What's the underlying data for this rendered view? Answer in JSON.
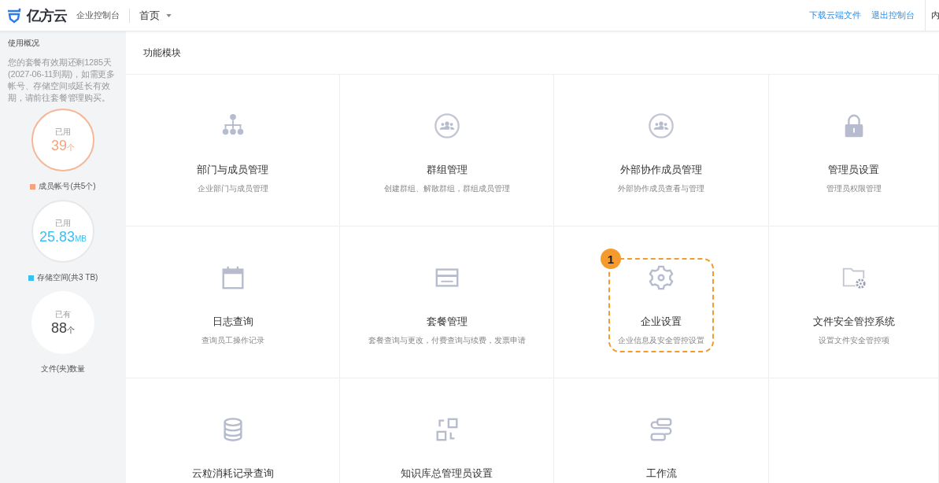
{
  "header": {
    "logo_text": "亿方云",
    "console_label": "企业控制台",
    "nav": {
      "label": "首页"
    },
    "links": [
      "下载云端文件",
      "退出控制台"
    ],
    "cut_text": "内"
  },
  "sidebar": {
    "title": "使用概况",
    "notice": "您的套餐有效期还剩1285天(2027-06-11到期)，如需更多帐号、存储空间或延长有效期，请前往套餐管理购买。",
    "stats": [
      {
        "caption": "已用",
        "value": "39",
        "unit": "个",
        "legend": "成员帐号(共5个)",
        "color": "#f4a37c",
        "over_limit": true
      },
      {
        "caption": "已用",
        "value": "25.83",
        "unit": "MB",
        "legend": "存储空间(共3 TB)",
        "color": "#3bbff0",
        "over_limit": false
      },
      {
        "caption": "已有",
        "value": "88",
        "unit": "个",
        "legend": "文件(夹)数量",
        "over_limit": false
      }
    ]
  },
  "main": {
    "title": "功能模块",
    "modules": [
      {
        "title": "部门与成员管理",
        "desc": "企业部门与成员管理",
        "highlighted": false
      },
      {
        "title": "群组管理",
        "desc": "创建群组、解散群组，群组成员管理",
        "highlighted": false
      },
      {
        "title": "外部协作成员管理",
        "desc": "外部协作成员查看与管理",
        "highlighted": false
      },
      {
        "title": "管理员设置",
        "desc": "管理员权限管理",
        "highlighted": false
      },
      {
        "title": "日志查询",
        "desc": "查询员工操作记录",
        "highlighted": false
      },
      {
        "title": "套餐管理",
        "desc": "套餐查询与更改，付费查询与续费，发票申请",
        "highlighted": false
      },
      {
        "title": "企业设置",
        "desc": "企业信息及安全管控设置",
        "highlighted": true,
        "badge": "1"
      },
      {
        "title": "文件安全管控系统",
        "desc": "设置文件安全管控项",
        "highlighted": false
      },
      {
        "title": "云粒消耗记录查询",
        "highlighted": false
      },
      {
        "title": "知识库总管理员设置",
        "highlighted": false
      },
      {
        "title": "工作流",
        "highlighted": false
      }
    ]
  }
}
